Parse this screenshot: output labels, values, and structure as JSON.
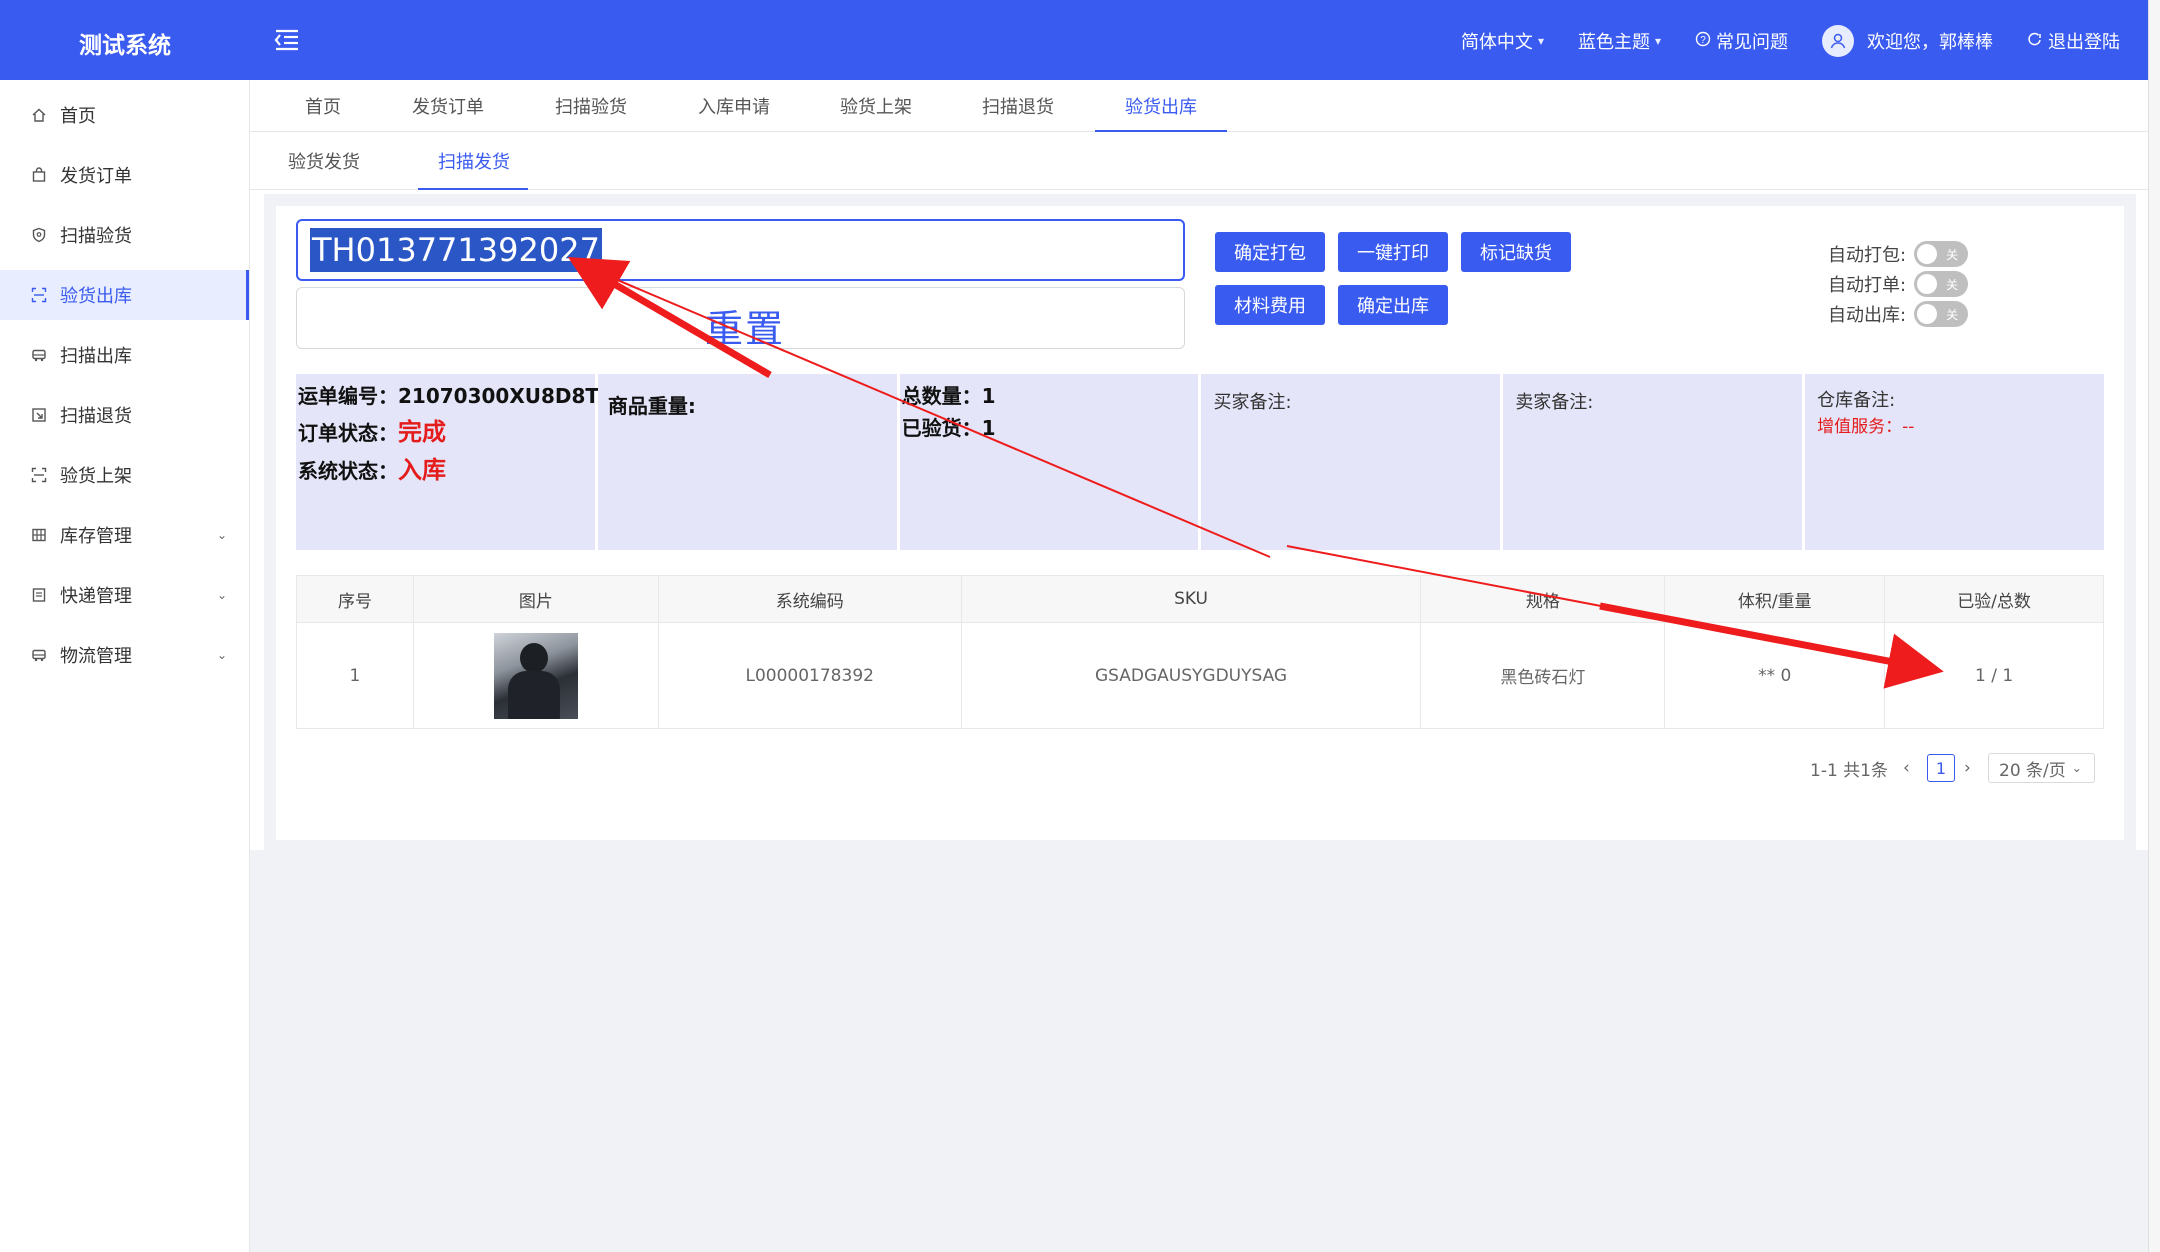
{
  "app": {
    "title": "测试系统"
  },
  "header": {
    "language": "简体中文",
    "theme": "蓝色主题",
    "faq": "常见问题",
    "welcome": "欢迎您，郭棒棒",
    "logout": "退出登陆"
  },
  "sidebar": {
    "items": [
      {
        "label": "首页",
        "icon": "home-icon"
      },
      {
        "label": "发货订单",
        "icon": "bag-icon"
      },
      {
        "label": "扫描验货",
        "icon": "shield-icon"
      },
      {
        "label": "验货出库",
        "icon": "scan-icon",
        "active": true
      },
      {
        "label": "扫描出库",
        "icon": "truck-icon"
      },
      {
        "label": "扫描退货",
        "icon": "return-icon"
      },
      {
        "label": "验货上架",
        "icon": "scan-icon"
      },
      {
        "label": "库存管理",
        "icon": "grid-icon",
        "expandable": true
      },
      {
        "label": "快递管理",
        "icon": "list-icon",
        "expandable": true
      },
      {
        "label": "物流管理",
        "icon": "truck-icon",
        "expandable": true
      }
    ]
  },
  "route_tabs": [
    "首页",
    "发货订单",
    "扫描验货",
    "入库申请",
    "验货上架",
    "扫描退货",
    "验货出库"
  ],
  "active_route_tab": "验货出库",
  "sub_tabs": [
    "验货发货",
    "扫描发货"
  ],
  "active_sub_tab": "扫描发货",
  "scan": {
    "value": "TH013771392027",
    "reset_label": "重置"
  },
  "buttons": {
    "confirm_pack": "确定打包",
    "print_all": "一键打印",
    "mark_missing": "标记缺货",
    "material_fee": "材料费用",
    "confirm_out": "确定出库"
  },
  "switches": [
    {
      "label": "自动打包:",
      "state": "关"
    },
    {
      "label": "自动打单:",
      "state": "关"
    },
    {
      "label": "自动出库:",
      "state": "关"
    }
  ],
  "info": {
    "waybill_label": "运单编号：",
    "waybill_value": "21070300XU8D8T",
    "order_status_label": "订单状态：",
    "order_status_value": "完成",
    "system_status_label": "系统状态：",
    "system_status_value": "入库",
    "weight_label": "商品重量:",
    "total_label": "总数量：",
    "total_value": "1",
    "checked_label": "已验货：",
    "checked_value": "1",
    "buyer_note": "买家备注:",
    "seller_note": "卖家备注:",
    "warehouse_note": "仓库备注:",
    "value_added": "增值服务：--"
  },
  "table": {
    "headers": [
      "序号",
      "图片",
      "系统编码",
      "SKU",
      "规格",
      "体积/重量",
      "已验/总数"
    ],
    "rows": [
      {
        "index": "1",
        "code": "L00000178392",
        "sku": "GSADGAUSYGDUYSAG",
        "spec": "黑色砖石灯",
        "volume": "** 0",
        "checked": "1 / 1"
      }
    ]
  },
  "pagination": {
    "summary": "1-1 共1条",
    "current_page": "1",
    "page_size": "20 条/页"
  },
  "colors": {
    "primary": "#3a5bf0",
    "info_bg": "#e4e5f8",
    "status_red": "#e51c1c",
    "annotation_arrow": "#ee1c1c"
  }
}
